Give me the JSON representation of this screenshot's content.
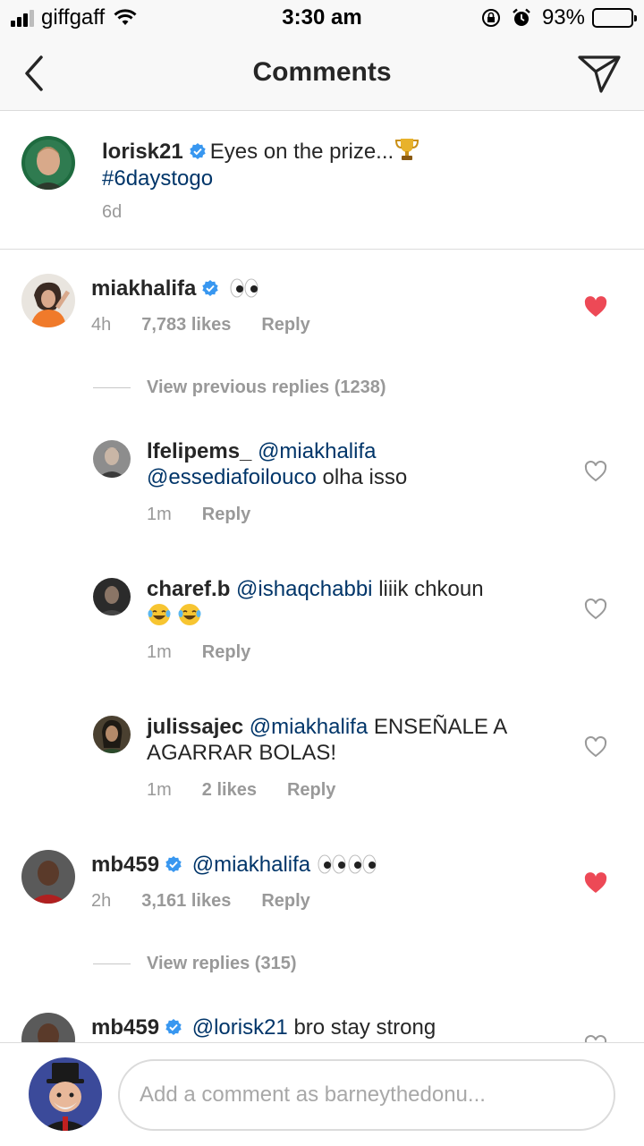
{
  "status_bar": {
    "carrier": "giffgaff",
    "time": "3:30 am",
    "battery_percent": "93%",
    "battery_level": 0.93,
    "icons": [
      "signal-icon",
      "wifi-icon",
      "rotation-lock-icon",
      "alarm-icon",
      "battery-icon"
    ]
  },
  "header": {
    "title": "Comments",
    "back_icon": "chevron-left-icon",
    "send_icon": "direct-send-icon"
  },
  "caption": {
    "username": "lorisk21",
    "verified": true,
    "text": "Eyes on the prize...",
    "emoji": "trophy",
    "hashtag": "#6daystogo",
    "time": "6d"
  },
  "comments": [
    {
      "username": "miakhalifa",
      "verified": true,
      "text": "",
      "emoji": "eyes",
      "time": "4h",
      "likes": "7,783 likes",
      "reply_label": "Reply",
      "liked": true,
      "view_replies": "View previous replies (1238)"
    },
    {
      "username": "lfelipems_",
      "mention": "@miakhalifa",
      "mention2": "@essediafoilouco",
      "text": "olha isso",
      "time": "1m",
      "reply_label": "Reply",
      "liked": false
    },
    {
      "username": "charef.b",
      "mention": "@ishaqchabbi",
      "text": "liiik chkoun",
      "emoji": "face-with-tears-of-joy x2",
      "time": "1m",
      "reply_label": "Reply",
      "liked": false
    },
    {
      "username": "julissajec",
      "mention": "@miakhalifa",
      "text": "ENSEÑALE A AGARRAR BOLAS!",
      "time": "1m",
      "likes": "2 likes",
      "reply_label": "Reply",
      "liked": false
    },
    {
      "username": "mb459",
      "verified": true,
      "mention": "@miakhalifa",
      "emoji": "eyes x2",
      "time": "2h",
      "likes": "3,161 likes",
      "reply_label": "Reply",
      "liked": true,
      "view_replies": "View replies (315)"
    },
    {
      "username": "mb459",
      "verified": true,
      "mention": "@lorisk21",
      "text": "bro stay strong",
      "liked": false
    }
  ],
  "composer": {
    "placeholder": "Add a comment as barneythedonu..."
  },
  "colors": {
    "link": "#003569",
    "verified": "#3897f0",
    "liked_heart": "#ed4956",
    "meta_gray": "#999999",
    "border": "#dbdbdb"
  }
}
